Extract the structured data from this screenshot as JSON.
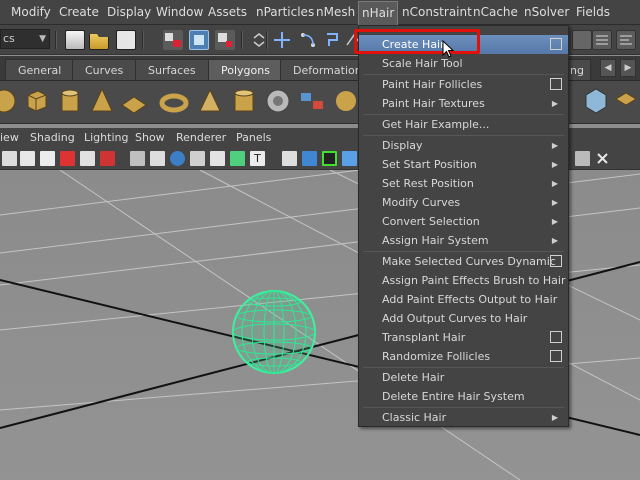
{
  "menubar": {
    "items": [
      "Modify",
      "Create",
      "Display",
      "Window",
      "Assets",
      "nParticles",
      "nMesh",
      "nHair",
      "nConstraint",
      "nCache",
      "nSolver",
      "Fields"
    ],
    "active": "nHair"
  },
  "statusline": {
    "mode_value": "cs"
  },
  "shelf_tabs": {
    "items": [
      "General",
      "Curves",
      "Surfaces",
      "Polygons",
      "Deformation",
      "ing"
    ],
    "active": "Polygons"
  },
  "panel_menu": {
    "items": [
      "iew",
      "Shading",
      "Lighting",
      "Show",
      "Renderer",
      "Panels"
    ]
  },
  "nhair_menu": {
    "items": [
      {
        "label": "Create Hair",
        "option_box": true,
        "highlighted": true
      },
      {
        "label": "Scale Hair Tool"
      },
      {
        "label": "Paint Hair Follicles",
        "option_box": true
      },
      {
        "label": "Paint Hair Textures",
        "submenu": true
      },
      {
        "label": "Get Hair Example..."
      },
      {
        "label": "Display",
        "submenu": true
      },
      {
        "label": "Set Start Position",
        "submenu": true
      },
      {
        "label": "Set Rest Position",
        "submenu": true
      },
      {
        "label": "Modify Curves",
        "submenu": true
      },
      {
        "label": "Convert Selection",
        "submenu": true
      },
      {
        "label": "Assign Hair System",
        "submenu": true
      },
      {
        "label": "Make Selected Curves Dynamic",
        "option_box": true
      },
      {
        "label": "Assign Paint Effects Brush to Hair"
      },
      {
        "label": "Add Paint Effects Output to Hair"
      },
      {
        "label": "Add Output Curves to Hair"
      },
      {
        "label": "Transplant Hair",
        "option_box": true
      },
      {
        "label": "Randomize Follicles",
        "option_box": true
      },
      {
        "label": "Delete Hair"
      },
      {
        "label": "Delete Entire Hair System"
      },
      {
        "label": "Classic Hair",
        "submenu": true
      }
    ]
  },
  "colors": {
    "highlight_outline": "#e0100b",
    "menu_highlight": "#5f82b3",
    "sphere_wireframe": "#3ff0a0",
    "ui_background": "#444444",
    "viewport_background": "#8f8f8f"
  }
}
